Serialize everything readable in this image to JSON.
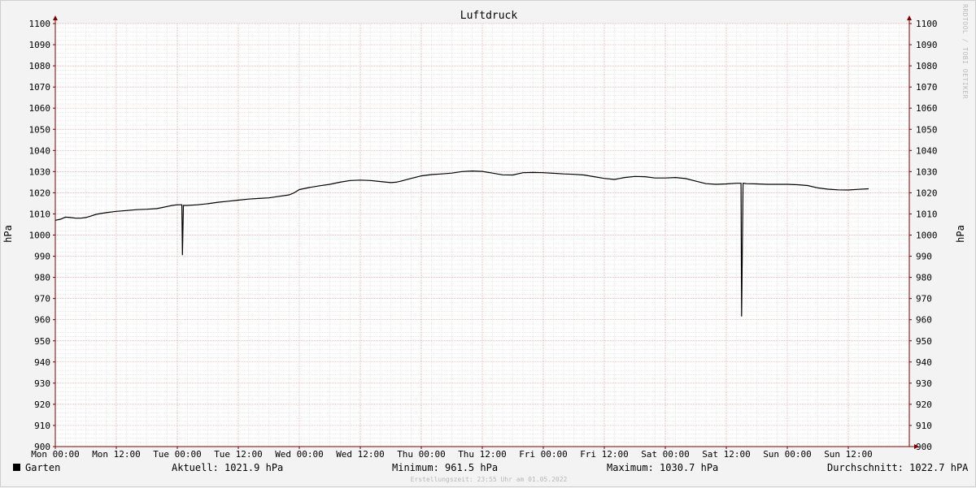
{
  "chart_data": {
    "type": "line",
    "title": "Luftdruck",
    "ylabel": "hPa",
    "ylim": [
      900,
      1100
    ],
    "y_ticks": [
      900,
      910,
      920,
      930,
      940,
      950,
      960,
      970,
      980,
      990,
      1000,
      1010,
      1020,
      1030,
      1040,
      1050,
      1060,
      1070,
      1080,
      1090,
      1100
    ],
    "x_ticks": [
      "Mon 00:00",
      "Mon 12:00",
      "Tue 00:00",
      "Tue 12:00",
      "Wed 00:00",
      "Wed 12:00",
      "Thu 00:00",
      "Thu 12:00",
      "Fri 00:00",
      "Fri 12:00",
      "Sat 00:00",
      "Sat 12:00",
      "Sun 00:00",
      "Sun 12:00"
    ],
    "x_unit": "hours since Mon 00:00",
    "xlim": [
      0,
      168
    ],
    "grid": true,
    "series": [
      {
        "name": "Garten",
        "color": "#000000",
        "points": [
          [
            0,
            1007
          ],
          [
            1,
            1007.5
          ],
          [
            2,
            1008.5
          ],
          [
            3,
            1008.3
          ],
          [
            4,
            1008
          ],
          [
            5,
            1008
          ],
          [
            6,
            1008.3
          ],
          [
            7,
            1009
          ],
          [
            8,
            1009.8
          ],
          [
            9,
            1010.2
          ],
          [
            10,
            1010.6
          ],
          [
            12,
            1011.2
          ],
          [
            14,
            1011.6
          ],
          [
            16,
            1012
          ],
          [
            18,
            1012.2
          ],
          [
            20,
            1012.5
          ],
          [
            21,
            1013
          ],
          [
            22,
            1013.5
          ],
          [
            23,
            1014
          ],
          [
            24,
            1014.3
          ],
          [
            24.9,
            1014.3
          ],
          [
            25,
            990.5
          ],
          [
            25.2,
            1014
          ],
          [
            26,
            1014
          ],
          [
            28,
            1014.3
          ],
          [
            30,
            1014.8
          ],
          [
            32,
            1015.5
          ],
          [
            34,
            1016
          ],
          [
            36,
            1016.5
          ],
          [
            38,
            1017
          ],
          [
            40,
            1017.3
          ],
          [
            42,
            1017.6
          ],
          [
            44,
            1018.3
          ],
          [
            46,
            1019
          ],
          [
            47,
            1020
          ],
          [
            48,
            1021.5
          ],
          [
            50,
            1022.5
          ],
          [
            52,
            1023.3
          ],
          [
            54,
            1024
          ],
          [
            56,
            1025
          ],
          [
            58,
            1025.8
          ],
          [
            60,
            1026
          ],
          [
            62,
            1025.8
          ],
          [
            64,
            1025.3
          ],
          [
            66,
            1024.8
          ],
          [
            67,
            1025
          ],
          [
            68,
            1025.5
          ],
          [
            70,
            1026.8
          ],
          [
            72,
            1028
          ],
          [
            74,
            1028.6
          ],
          [
            76,
            1028.9
          ],
          [
            78,
            1029.3
          ],
          [
            80,
            1030
          ],
          [
            82,
            1030.3
          ],
          [
            84,
            1030.1
          ],
          [
            86,
            1029.3
          ],
          [
            88,
            1028.5
          ],
          [
            90,
            1028.4
          ],
          [
            92,
            1029.5
          ],
          [
            94,
            1029.6
          ],
          [
            96,
            1029.5
          ],
          [
            98,
            1029.2
          ],
          [
            100,
            1028.9
          ],
          [
            102,
            1028.7
          ],
          [
            104,
            1028.4
          ],
          [
            106,
            1027.6
          ],
          [
            108,
            1026.8
          ],
          [
            110,
            1026.3
          ],
          [
            112,
            1027.2
          ],
          [
            114,
            1027.7
          ],
          [
            116,
            1027.6
          ],
          [
            118,
            1027
          ],
          [
            120,
            1027
          ],
          [
            122,
            1027.2
          ],
          [
            124,
            1026.7
          ],
          [
            126,
            1025.5
          ],
          [
            128,
            1024.3
          ],
          [
            130,
            1024
          ],
          [
            132,
            1024.2
          ],
          [
            134,
            1024.5
          ],
          [
            134.9,
            1024.5
          ],
          [
            135,
            961.5
          ],
          [
            135.3,
            1024.5
          ],
          [
            136,
            1024.3
          ],
          [
            138,
            1024.2
          ],
          [
            140,
            1024
          ],
          [
            142,
            1024
          ],
          [
            144,
            1024
          ],
          [
            146,
            1023.8
          ],
          [
            148,
            1023.4
          ],
          [
            150,
            1022.3
          ],
          [
            152,
            1021.7
          ],
          [
            154,
            1021.4
          ],
          [
            156,
            1021.3
          ],
          [
            158,
            1021.6
          ],
          [
            160,
            1021.9
          ]
        ]
      }
    ]
  },
  "legend": {
    "name": "Garten",
    "current": "Aktuell: 1021.9 hPa",
    "minimum": "Minimum: 961.5 hPa",
    "maximum": "Maximum: 1030.7 hPa",
    "average": "Durchschnitt: 1022.7 hPA"
  },
  "footer": "Erstellungszeit: 23:55 Uhr am 01.05.2022",
  "watermark": "RRDTOOL / TOBI OETIKER",
  "colors": {
    "background": "#f3f3f3",
    "plot": "#ffffff",
    "grid_minor": "#dcdcdc",
    "grid_major": "#e8a0a0",
    "axis": "#7a0000",
    "line": "#000000"
  }
}
